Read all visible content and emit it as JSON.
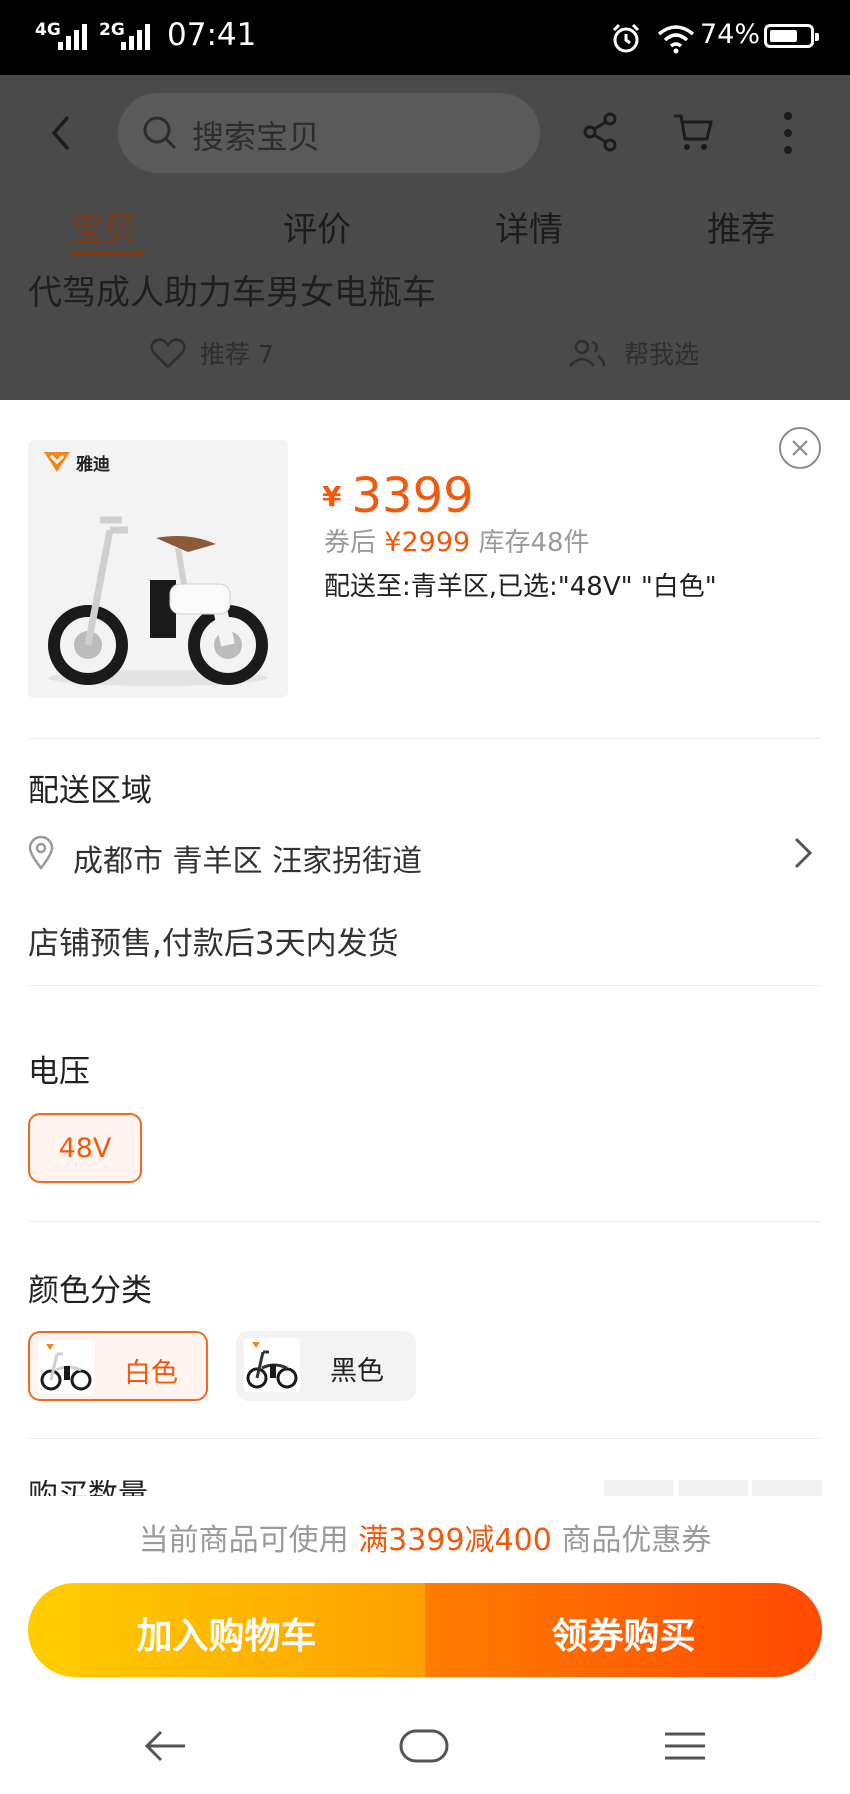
{
  "status_bar": {
    "network1": "4G",
    "network2": "2G",
    "time": "07:41",
    "battery_pct": "74%",
    "battery_level": 0.74
  },
  "header": {
    "search_placeholder": "搜索宝贝",
    "tabs": [
      "宝贝",
      "评价",
      "详情",
      "推荐"
    ],
    "active_tab": "宝贝"
  },
  "background_product": {
    "title": "代驾成人助力车男女电瓶车",
    "recommend_label": "推荐 7",
    "help_label": "帮我选"
  },
  "sheet": {
    "logo_text": "雅迪",
    "currency": "¥",
    "price": "3399",
    "coupon_prefix": "券后",
    "coupon_price": "¥2999",
    "stock": "库存48件",
    "delivery_summary": "配送至:青羊区,已选:\"48V\" \"白色\"",
    "delivery_area": {
      "title": "配送区域",
      "address": "成都市 青羊区 汪家拐街道",
      "presale": "店铺预售,付款后3天内发货"
    },
    "voltage": {
      "title": "电压",
      "options": [
        "48V"
      ],
      "selected": "48V"
    },
    "color": {
      "title": "颜色分类",
      "options": [
        "白色",
        "黑色"
      ],
      "selected": "白色"
    },
    "quantity": {
      "title": "购买数量"
    }
  },
  "coupon_tip": {
    "prefix": "当前商品可使用",
    "highlight": "满3399减400",
    "suffix": "商品优惠券"
  },
  "actions": {
    "add_to_cart": "加入购物车",
    "buy_with_coupon": "领券购买"
  },
  "colors": {
    "accent": "#f05a0f",
    "cart_gradient": [
      "#ffcd00",
      "#ffa000"
    ],
    "buy_gradient": [
      "#ff7d00",
      "#ff4a00"
    ]
  }
}
